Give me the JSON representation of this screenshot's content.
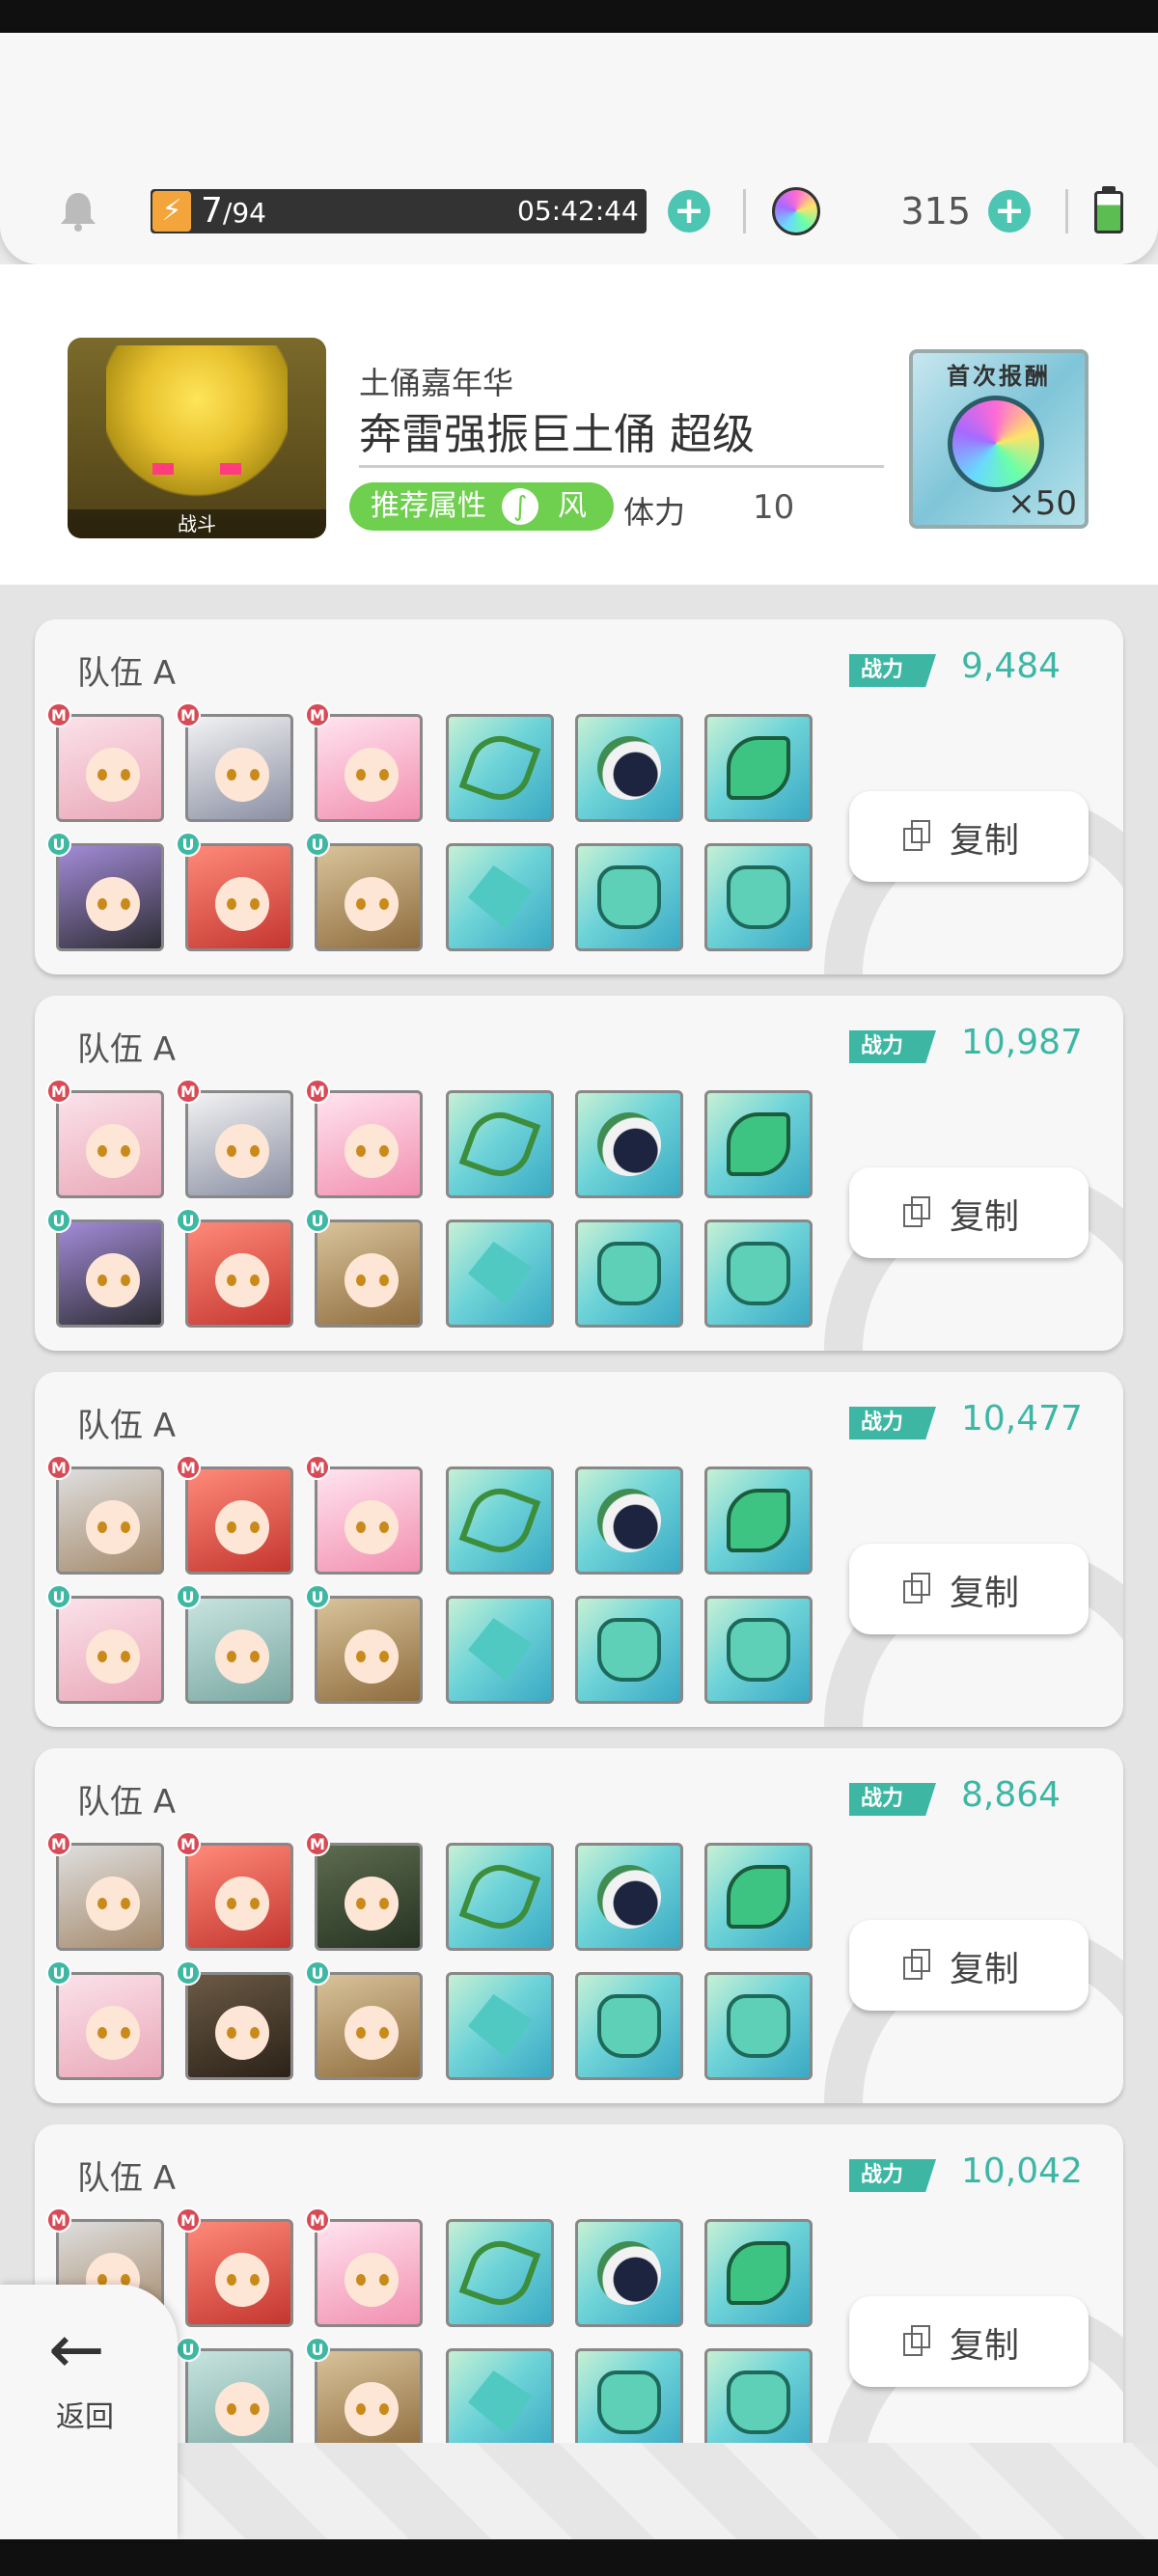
{
  "topbar": {
    "stamina_current": "7",
    "stamina_max": "/94",
    "timer": "05:42:44",
    "gem_count": "315"
  },
  "stage": {
    "thumb_label": "战斗",
    "event_name": "土俑嘉年华",
    "title": "奔雷强振巨土俑 超级",
    "recommended_label": "推荐属性",
    "recommended_value": "风",
    "stamina_label": "体力",
    "stamina_cost": "10"
  },
  "reward": {
    "title": "首次报酬",
    "count": "×50"
  },
  "power_label": "战力",
  "copy_label": "复制",
  "teams": [
    {
      "name": "队伍 A",
      "power": "9,484"
    },
    {
      "name": "队伍 A",
      "power": "10,987"
    },
    {
      "name": "队伍 A",
      "power": "10,477"
    },
    {
      "name": "队伍 A",
      "power": "8,864"
    },
    {
      "name": "队伍 A",
      "power": "10,042"
    }
  ],
  "back_label": "返回",
  "badges": {
    "main": "M",
    "unison": "U"
  },
  "colors": {
    "accent": "#3db7a4",
    "recommended": "#6fcf4e",
    "stamina_bolt": "#f3a53b"
  },
  "icons": {
    "bell": "bell-icon",
    "bolt": "lightning-icon",
    "plus": "plus-icon",
    "gem": "gem-icon",
    "battery": "battery-icon",
    "copy": "copy-icon",
    "back": "arrow-left-icon",
    "wind": "wind-icon"
  }
}
